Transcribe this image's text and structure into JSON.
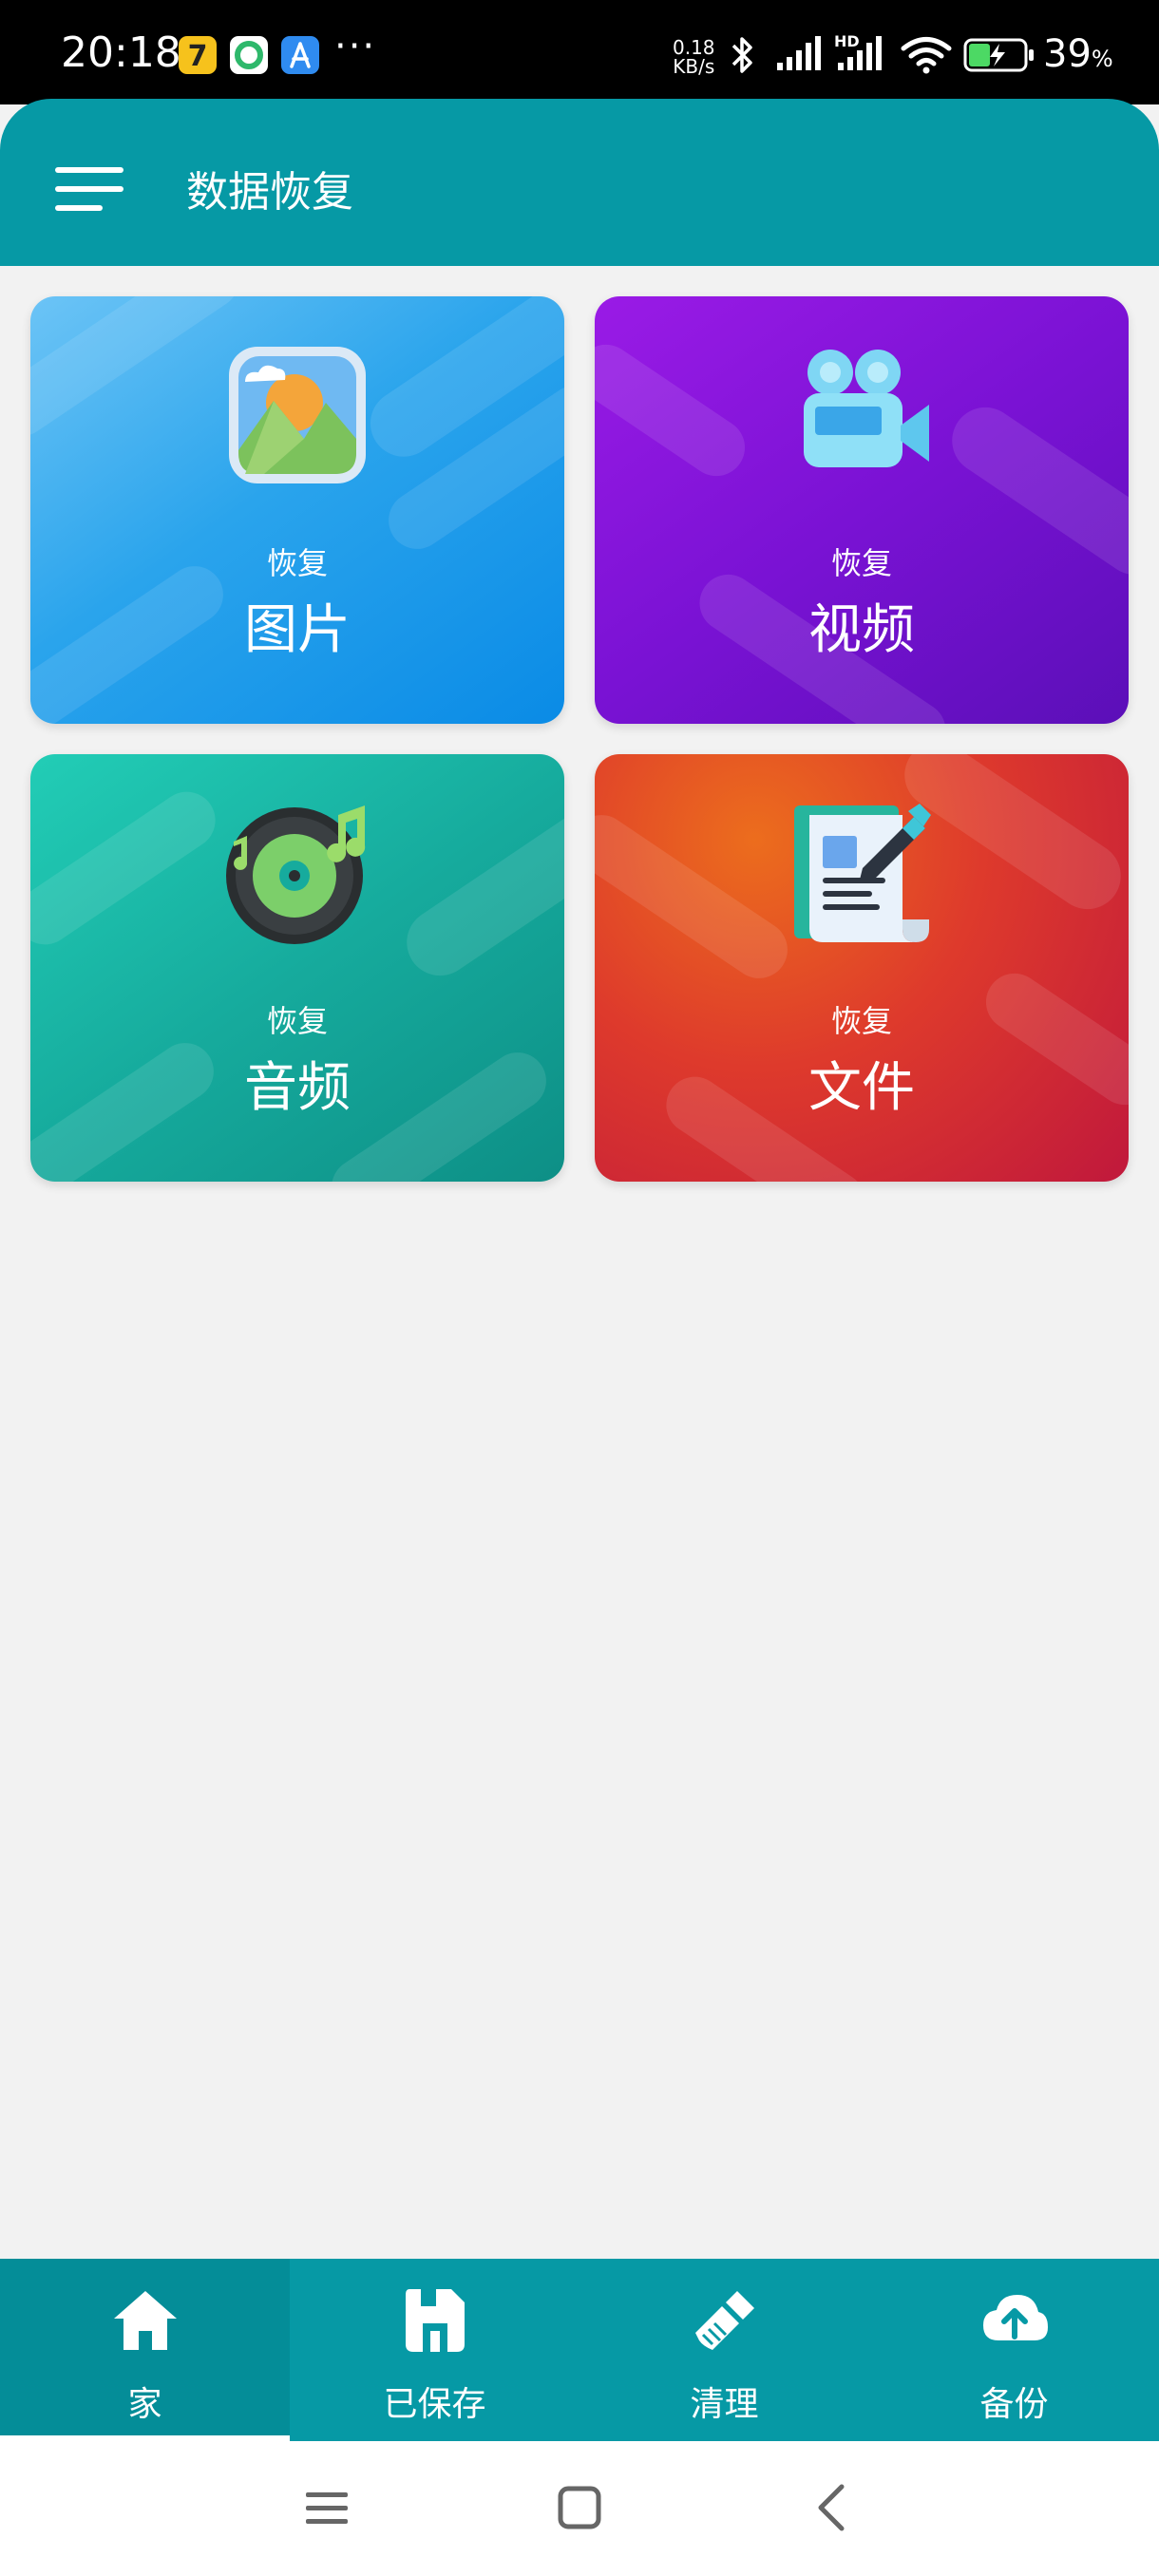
{
  "status_bar": {
    "time": "20:18",
    "more": "···",
    "net_speed_value": "0.18",
    "net_speed_unit": "KB/s",
    "signal2_label": "HD",
    "battery_percent": "39",
    "battery_unit": "%",
    "battery_level": 0.39,
    "app_icons": [
      "app-7-icon",
      "green-circle-app-icon",
      "app-store-icon"
    ]
  },
  "header": {
    "title": "数据恢复",
    "menu_icon": "hamburger-menu-icon"
  },
  "cards": [
    {
      "sub": "恢复",
      "label": "图片",
      "icon": "picture-icon",
      "color": "#1a98ea"
    },
    {
      "sub": "恢复",
      "label": "视频",
      "icon": "video-camera-icon",
      "color": "#7a12d4"
    },
    {
      "sub": "恢复",
      "label": "音频",
      "icon": "music-disc-icon",
      "color": "#16ab9d"
    },
    {
      "sub": "恢复",
      "label": "文件",
      "icon": "document-icon",
      "color": "#d8322f"
    }
  ],
  "bottom_nav": {
    "active_index": 0,
    "items": [
      {
        "label": "家",
        "icon": "home-icon"
      },
      {
        "label": "已保存",
        "icon": "save-icon"
      },
      {
        "label": "清理",
        "icon": "broom-icon"
      },
      {
        "label": "备份",
        "icon": "cloud-upload-icon"
      }
    ]
  },
  "system_nav": {
    "buttons": [
      "menu-icon",
      "home-square-icon",
      "back-icon"
    ]
  },
  "colors": {
    "primary": "#0699a5",
    "primary_dark": "#048d98",
    "background": "#f2f2f2"
  }
}
